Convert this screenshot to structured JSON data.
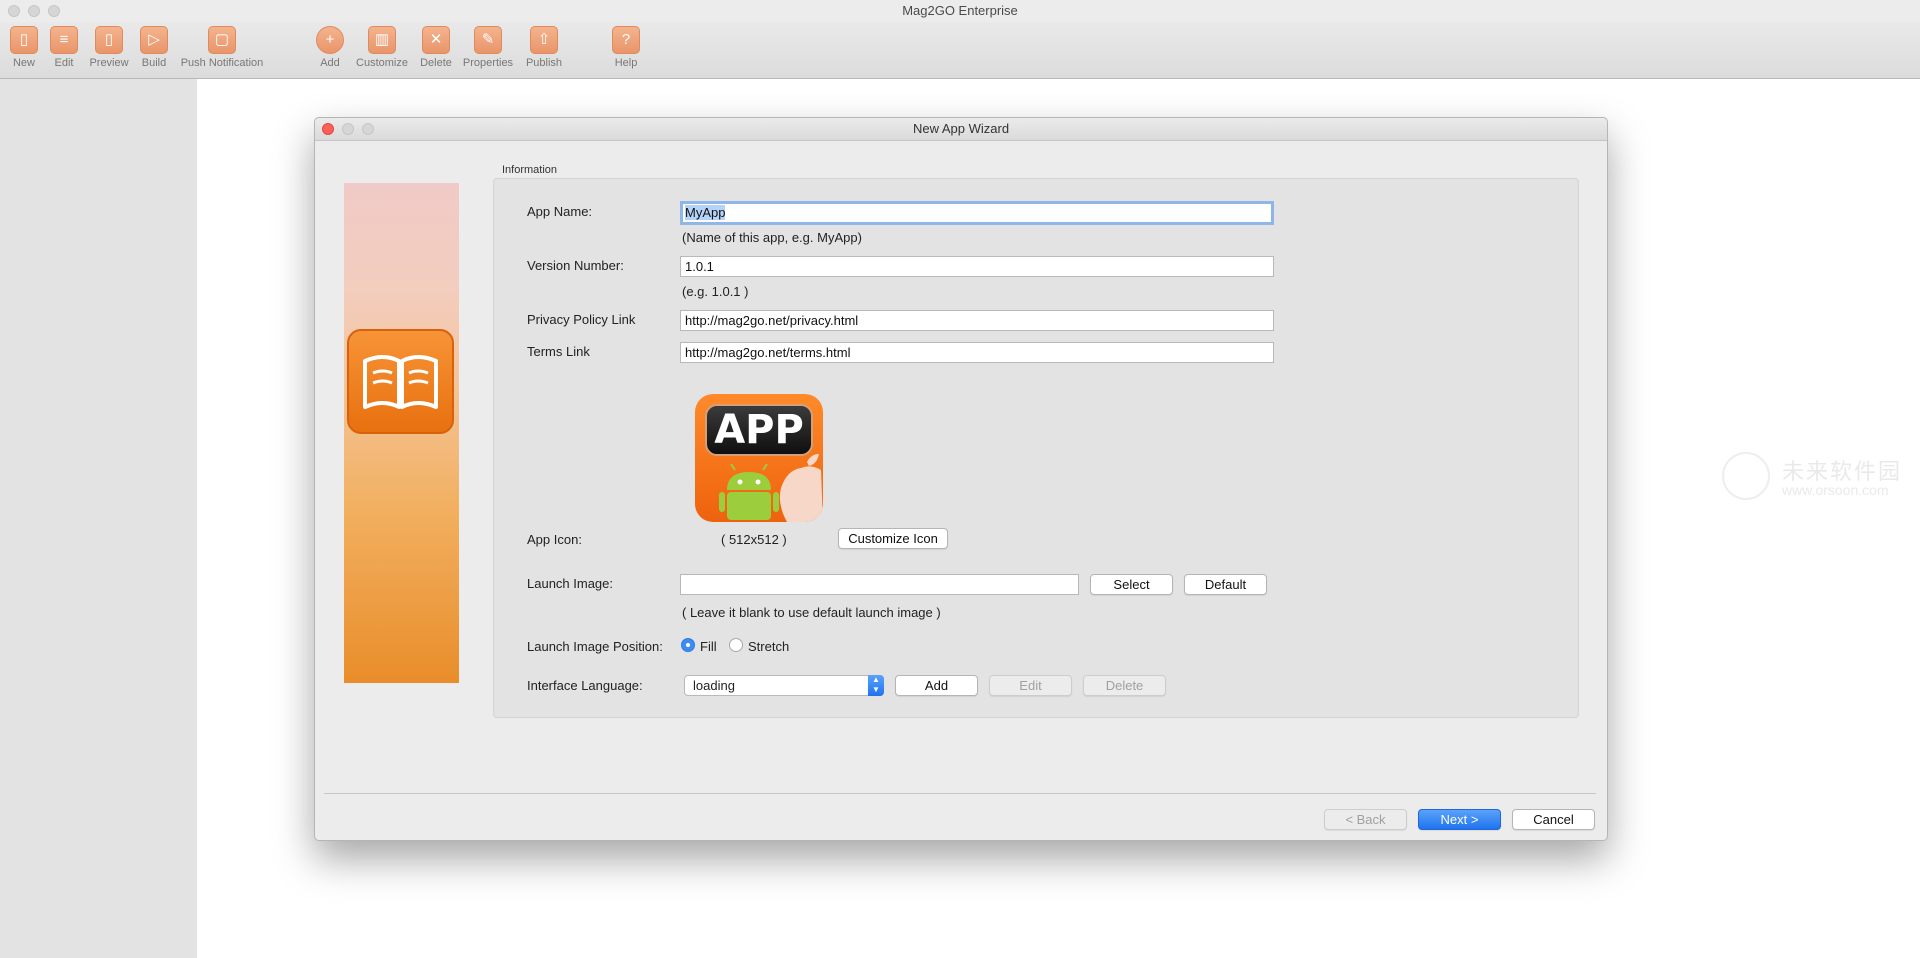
{
  "window": {
    "title": "Mag2GO Enterprise"
  },
  "toolbar": {
    "items": [
      {
        "label": "New",
        "icon": "new-document-icon"
      },
      {
        "label": "Edit",
        "icon": "edit-list-icon"
      },
      {
        "label": "Preview",
        "icon": "phone-preview-icon"
      },
      {
        "label": "Build",
        "icon": "play-build-icon"
      },
      {
        "label": "Push Notification",
        "icon": "push-notification-icon"
      },
      {
        "label": "Add",
        "icon": "add-plus-icon"
      },
      {
        "label": "Customize",
        "icon": "book-customize-icon"
      },
      {
        "label": "Delete",
        "icon": "delete-x-icon"
      },
      {
        "label": "Properties",
        "icon": "properties-pencil-icon"
      },
      {
        "label": "Publish",
        "icon": "publish-share-icon"
      },
      {
        "label": "Help",
        "icon": "help-question-icon"
      }
    ]
  },
  "watermark": {
    "line1": "未来软件园",
    "line2": "www.orsoon.com"
  },
  "dialog": {
    "title": "New App Wizard",
    "group_label": "Information",
    "app_name": {
      "label": "App Name:",
      "value": "MyApp",
      "hint": "(Name of this app, e.g. MyApp)"
    },
    "version": {
      "label": "Version Number:",
      "value": "1.0.1",
      "hint": "(e.g. 1.0.1 )"
    },
    "privacy": {
      "label": "Privacy Policy Link",
      "value": "http://mag2go.net/privacy.html"
    },
    "terms": {
      "label": "Terms Link",
      "value": "http://mag2go.net/terms.html"
    },
    "app_icon": {
      "label": "App Icon:",
      "badge_text": "APP",
      "size_text": "( 512x512 )",
      "customize_label": "Customize Icon"
    },
    "launch_image": {
      "label": "Launch Image:",
      "value": "",
      "select_label": "Select",
      "default_label": "Default",
      "hint": "( Leave it blank to use default launch image )"
    },
    "launch_position": {
      "label": "Launch Image Position:",
      "options": [
        "Fill",
        "Stretch"
      ],
      "selected": "Fill"
    },
    "interface_language": {
      "label": "Interface Language:",
      "value": "loading",
      "add_label": "Add",
      "edit_label": "Edit",
      "delete_label": "Delete"
    },
    "footer": {
      "back_label": "< Back",
      "next_label": "Next >",
      "cancel_label": "Cancel"
    }
  },
  "colors": {
    "accent": "#1f73ef",
    "toolbar_icon": "#e9956a",
    "close_button": "#fc5f57",
    "banner_orange": "#e98d2a"
  }
}
